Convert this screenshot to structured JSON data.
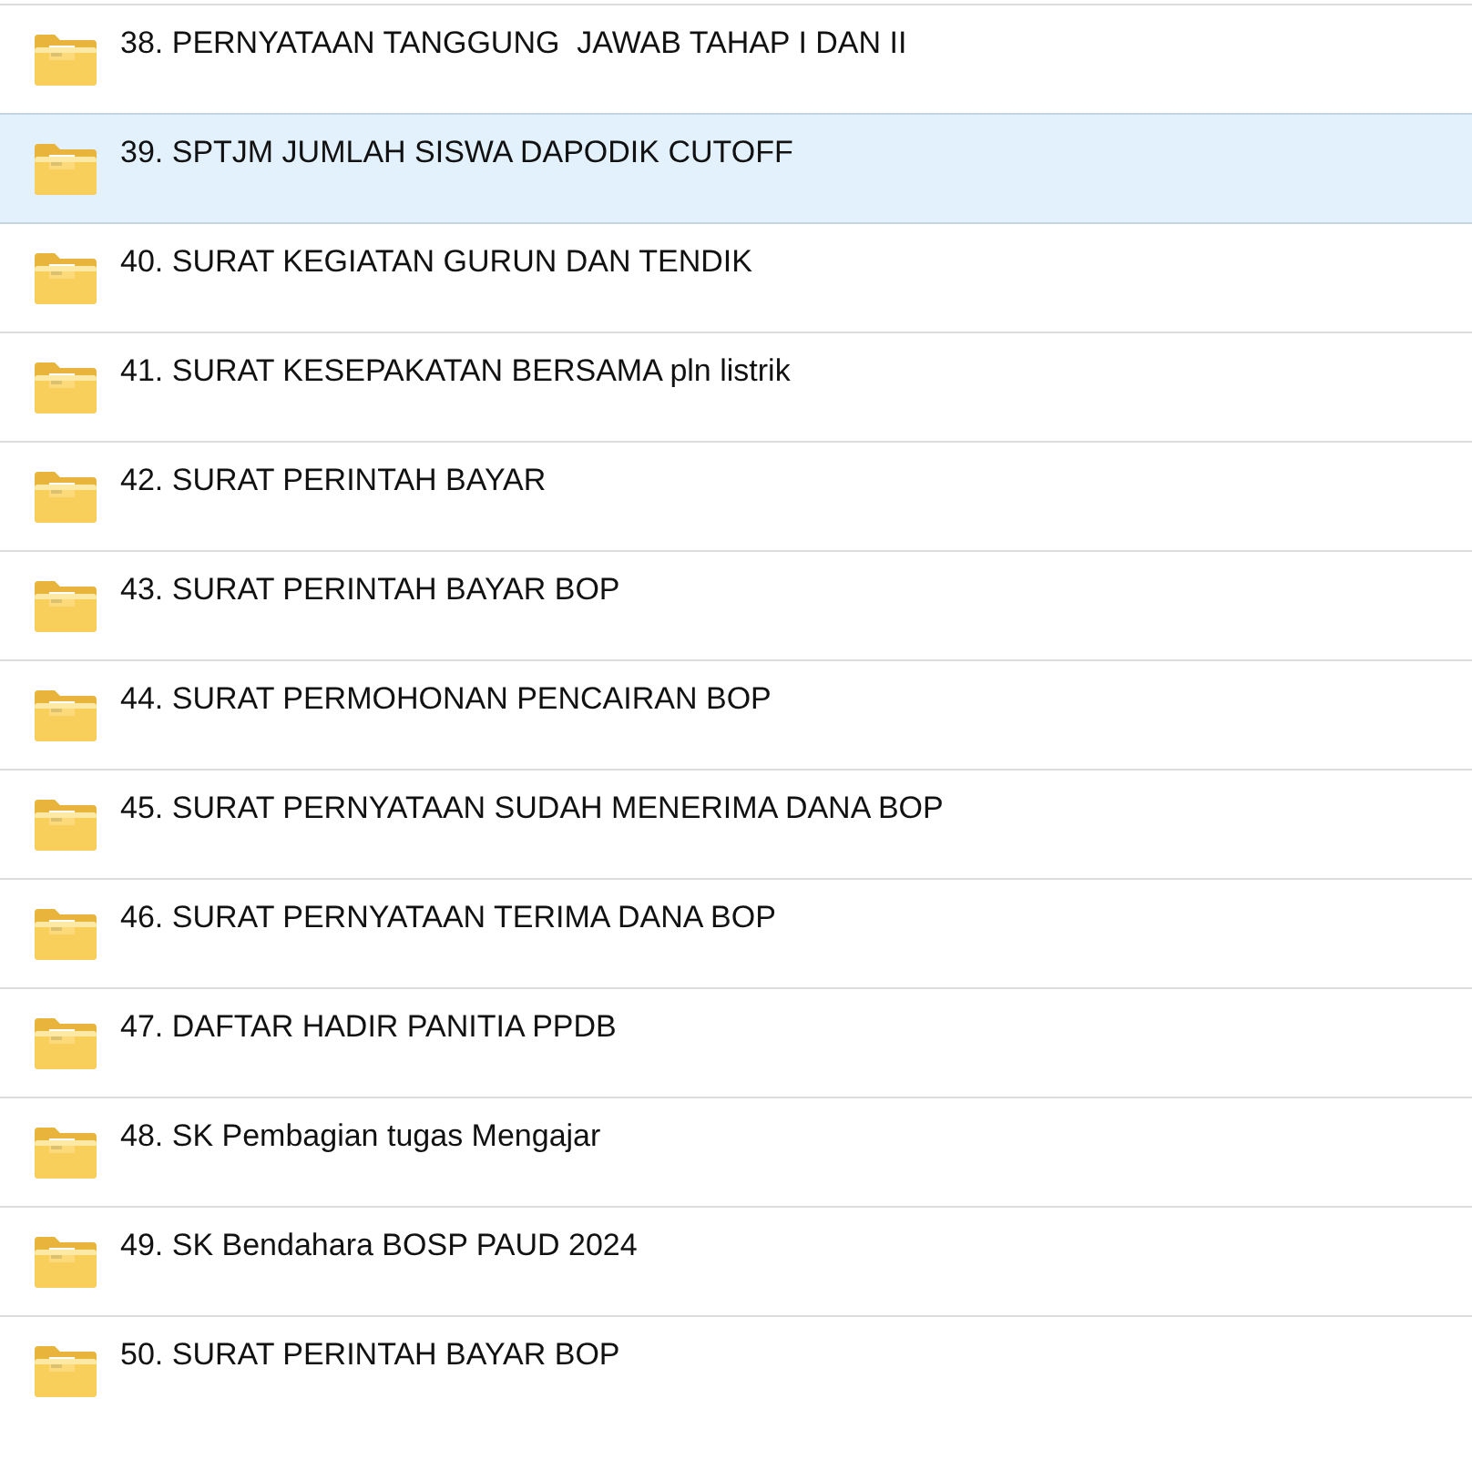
{
  "items": [
    {
      "label": "38. PERNYATAAN TANGGUNG  JAWAB TAHAP I DAN II",
      "selected": false
    },
    {
      "label": "39. SPTJM JUMLAH SISWA DAPODIK CUTOFF",
      "selected": true
    },
    {
      "label": "40. SURAT KEGIATAN GURUN DAN TENDIK",
      "selected": false
    },
    {
      "label": "41. SURAT KESEPAKATAN BERSAMA pln listrik",
      "selected": false
    },
    {
      "label": "42. SURAT PERINTAH BAYAR",
      "selected": false
    },
    {
      "label": "43. SURAT PERINTAH BAYAR BOP",
      "selected": false
    },
    {
      "label": "44. SURAT PERMOHONAN PENCAIRAN BOP",
      "selected": false
    },
    {
      "label": "45. SURAT PERNYATAAN SUDAH MENERIMA DANA BOP",
      "selected": false
    },
    {
      "label": "46. SURAT PERNYATAAN TERIMA DANA BOP",
      "selected": false
    },
    {
      "label": "47. DAFTAR HADIR PANITIA PPDB",
      "selected": false
    },
    {
      "label": "48. SK Pembagian tugas Mengajar",
      "selected": false
    },
    {
      "label": "49. SK Bendahara BOSP PAUD 2024",
      "selected": false
    },
    {
      "label": "50. SURAT PERINTAH BAYAR BOP",
      "selected": false
    }
  ]
}
